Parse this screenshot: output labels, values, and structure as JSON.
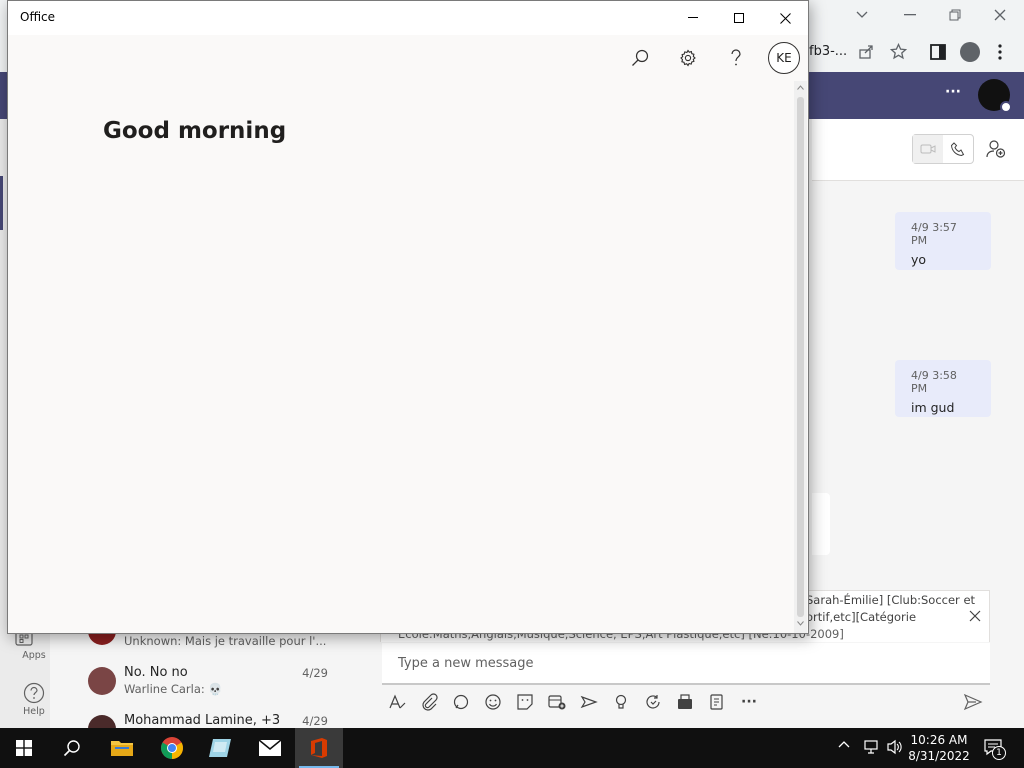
{
  "browser": {
    "tab_fragment": "fb3-..."
  },
  "teams": {
    "more_label": "···",
    "messages": [
      {
        "time": "4/9 3:57 PM",
        "text": "yo"
      },
      {
        "time": "4/9 3:58 PM",
        "text": "im gud"
      }
    ],
    "rail": {
      "apps_label": "Apps",
      "help_label": "Help"
    },
    "chat_list": [
      {
        "name": "",
        "preview": "Unknown: Mais je travaille pour l'...",
        "date": ""
      },
      {
        "name": "No. No no",
        "preview": "Warline Carla: 💀",
        "date": "4/29"
      },
      {
        "name": "Mohammad Lamine, +3",
        "preview": "",
        "date": "4/29"
      }
    ],
    "compose_quote_line1": "Sarah-Émilie] [Club:Soccer et",
    "compose_quote_line2": "ortif,etc][Catégorie",
    "compose_quote_line3": "École:Maths,Anglais,Musique,Science, EPS,Art Plastique,etc] [Né:10-10-2009]",
    "compose_placeholder": "Type a new message"
  },
  "office": {
    "window_title": "Office",
    "greeting": "Good morning",
    "avatar_initials": "KE"
  },
  "taskbar": {
    "time": "10:26 AM",
    "date": "8/31/2022",
    "notification_count": "1"
  },
  "colors": {
    "teams_purple": "#464775",
    "bubble": "#e8ebfa",
    "office_bg": "#faf9f8",
    "taskbar": "#101010",
    "office_red": "#d83b01"
  }
}
